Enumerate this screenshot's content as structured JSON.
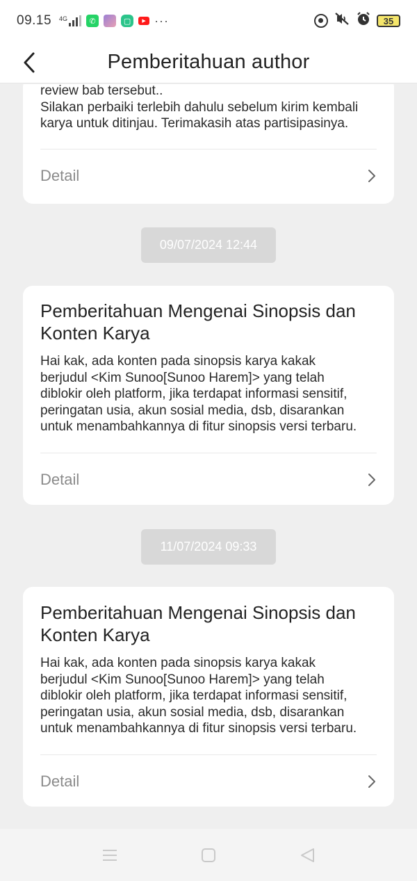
{
  "status_bar": {
    "time": "09.15",
    "network": "4G",
    "battery": "35",
    "icons": [
      "signal-icon",
      "whatsapp-icon",
      "app-avatar-icon",
      "chat-icon",
      "youtube-icon",
      "more-dots-icon",
      "focus-icon",
      "mute-icon",
      "alarm-icon",
      "battery-icon"
    ],
    "more": "···"
  },
  "header": {
    "title": "Pemberitahuan author",
    "back_icon": "chevron-left-icon"
  },
  "notifications": [
    {
      "title": "",
      "body_lines": [
        "review bab tersebut..",
        "Silakan perbaiki terlebih dahulu sebelum kirim kembali",
        "karya untuk ditinjau. Terimakasih atas partisipasinya."
      ],
      "detail_label": "Detail"
    },
    {
      "timestamp": "09/07/2024 12:44",
      "title_lines": [
        "Pemberitahuan Mengenai Sinopsis dan",
        "Konten Karya"
      ],
      "body_lines": [
        "Hai kak, ada konten pada sinopsis karya kakak",
        "berjudul <Kim Sunoo[Sunoo Harem]>  yang telah",
        "diblokir oleh platform, jika terdapat informasi sensitif,",
        "peringatan usia, akun sosial media, dsb, disarankan",
        "untuk menambahkannya di fitur sinopsis versi terbaru."
      ],
      "detail_label": "Detail"
    },
    {
      "timestamp": "11/07/2024 09:33",
      "title_lines": [
        "Pemberitahuan Mengenai Sinopsis dan",
        "Konten Karya"
      ],
      "body_lines": [
        "Hai kak, ada konten pada sinopsis karya kakak",
        "berjudul <Kim Sunoo[Sunoo Harem]>  yang telah",
        "diblokir oleh platform, jika terdapat informasi sensitif,",
        "peringatan usia, akun sosial media, dsb, disarankan",
        "untuk menambahkannya di fitur sinopsis versi terbaru."
      ],
      "detail_label": "Detail"
    }
  ],
  "nav_bar": {
    "icons": [
      "menu-icon",
      "home-icon",
      "back-triangle-icon"
    ]
  },
  "colors": {
    "background": "#efefef",
    "card": "#ffffff",
    "timestamp_bg": "#d8d8d8",
    "detail_text": "#8a8a8a",
    "whatsapp": "#25d366",
    "youtube": "#ff0000"
  }
}
